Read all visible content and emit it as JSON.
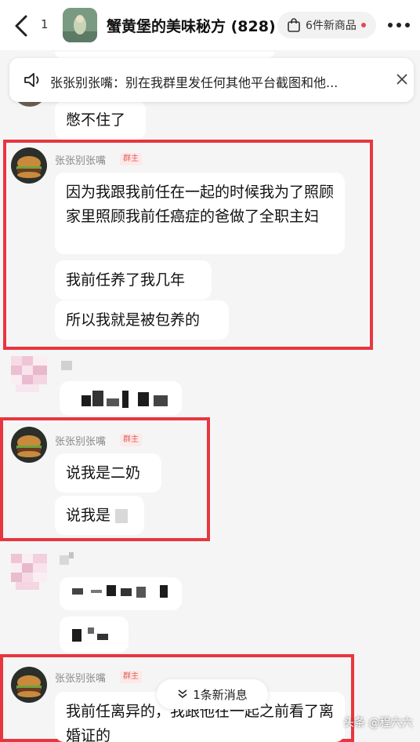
{
  "header": {
    "unread_count": "1",
    "group_title": "蟹黄堡的美味秘方 (828)",
    "goods_label": "6件新商品"
  },
  "notice": {
    "text": "张张别张嘴：别在我群里发任何其他平台截图和他..."
  },
  "messages": [
    {
      "text": "憋不住了"
    },
    {
      "sender": "张张别张嘴",
      "badge": "群主",
      "bubbles": [
        "因为我跟我前任在一起的时候我为了照顾家里照顾我前任癌症的爸做了全职主妇",
        "我前任养了我几年",
        "所以我就是被包养的"
      ]
    },
    {
      "sender": "张张别张嘴",
      "badge": "群主",
      "bubbles": [
        "说我是二奶",
        "说我是"
      ]
    },
    {
      "sender": "张张别张嘴",
      "badge": "群主",
      "bubbles": [
        "我前任离异的，我跟他在一起之前看了离婚证的"
      ]
    }
  ],
  "new_messages": {
    "label": "1条新消息"
  },
  "watermark": "头条 @程六六",
  "colors": {
    "highlight_frame": "#e8363f",
    "badge": "#e0605a",
    "background": "#f5f5f6"
  }
}
